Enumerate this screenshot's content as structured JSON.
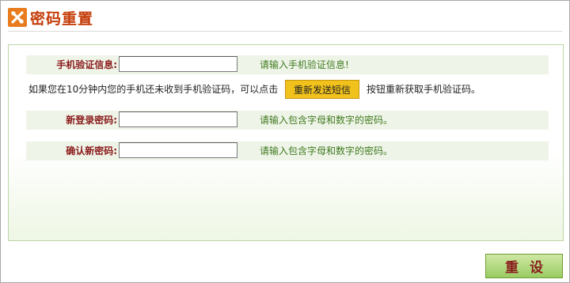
{
  "page": {
    "title": "密码重置",
    "title_icon": "wrench-cross-icon"
  },
  "form": {
    "sms_label": "手机验证信息:",
    "sms_hint": "请输入手机验证信息!",
    "resend_prefix": "如果您在10分钟内您的手机还未收到手机验证码，可以点击",
    "resend_button": "重新发送短信",
    "resend_suffix": "按钮重新获取手机验证码。",
    "new_password_label": "新登录密码:",
    "new_password_hint": "请输入包含字母和数字的密码。",
    "confirm_password_label": "确认新密码:",
    "confirm_password_hint": "请输入包含字母和数字的密码。",
    "sms_value": "",
    "new_password_value": "",
    "confirm_password_value": ""
  },
  "actions": {
    "reset_label": "重设"
  },
  "colors": {
    "title": "#c43d0a",
    "label": "#8a1c1c",
    "hint": "#3e7a1e",
    "accent_button": "#f1c21b",
    "reset_button": "#9acc62"
  }
}
